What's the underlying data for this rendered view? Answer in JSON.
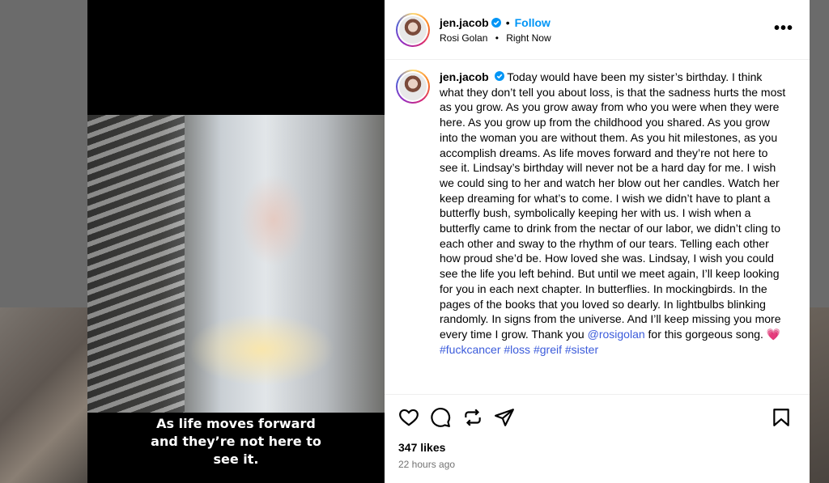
{
  "post": {
    "author": "jen.jacob",
    "follow_label": "Follow",
    "separator": "•",
    "audio_artist": "Rosi Golan",
    "audio_status": "Right Now",
    "more_label": "•••",
    "caption_lines": [
      "As life moves forward",
      "and they’re not here to",
      "see it."
    ],
    "body_text": "Today would have been my sister’s birthday. I think what they don’t tell you about loss, is that the sadness hurts the most as you grow. As you grow away from who you were when they were here. As you grow up from the childhood you shared. As you grow into the woman you are without them. As you hit milestones, as you accomplish dreams. As life moves forward and they’re not here to see it. Lindsay’s birthday will never not be a hard day for me. I wish we could sing to her and watch her blow out her candles. Watch her keep dreaming for what’s to come. I wish we didn’t have to plant a butterfly bush, symbolically keeping her with us. I wish when a butterfly came to drink from the nectar of our labor, we didn’t cling to each other and sway to the rhythm of our tears. Telling each other how proud she’d be. How loved she was. Lindsay, I wish you could see the life you left behind. But until we meet again, I’ll keep looking for you in each next chapter. In butterflies. In mockingbirds. In the pages of the books that you loved so dearly. In lightbulbs blinking randomly. In signs from the universe. And I’ll keep missing you more every time I grow. Thank you ",
    "mention": "@rosigolan",
    "body_tail": " for this gorgeous song. ",
    "heart_emoji": "💗",
    "hashtags": [
      "#fuckcancer",
      "#loss",
      "#greif",
      "#sister"
    ],
    "likes": "347 likes",
    "time_ago": "22 hours ago"
  },
  "colors": {
    "accent_blue": "#0095f6",
    "link_blue": "#3b5bdb",
    "heart_pink": "#ff2d8a",
    "muted_text": "#737373"
  },
  "icons": {
    "verified": "verified-badge-icon",
    "like": "heart-outline-icon",
    "comment": "comment-bubble-icon",
    "share": "repost-icon",
    "send": "paper-plane-icon",
    "save": "bookmark-icon",
    "more": "more-options-icon"
  }
}
